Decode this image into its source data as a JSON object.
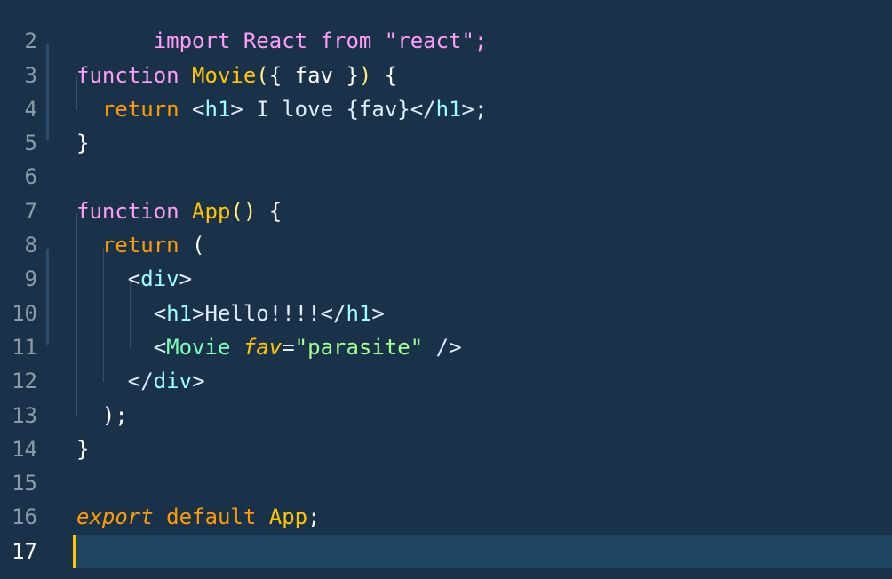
{
  "editor": {
    "line_numbers": [
      "2",
      "3",
      "4",
      "5",
      "6",
      "7",
      "8",
      "9",
      "10",
      "11",
      "12",
      "13",
      "14",
      "15",
      "16",
      "17"
    ],
    "active_line": "17",
    "lines": [
      {
        "top_partial": "import React from \"react\";"
      },
      {
        "t1": "function",
        "t2": " ",
        "t3": "Movie",
        "t4": "(",
        "t5": "{ fav }",
        "t6": ")",
        "t7": " {"
      },
      {
        "t1": "  ",
        "t2": "return",
        "t3": " <",
        "t4": "h1",
        "t5": "> I love {fav}</",
        "t6": "h1",
        "t7": ">;"
      },
      {
        "t1": "}"
      },
      {
        "t1": ""
      },
      {
        "t1": "function",
        "t2": " ",
        "t3": "App",
        "t4": "()",
        "t5": " {"
      },
      {
        "t1": "  ",
        "t2": "return",
        "t3": " ("
      },
      {
        "t1": "    <",
        "t2": "div",
        "t3": ">"
      },
      {
        "t1": "      <",
        "t2": "h1",
        "t3": ">Hello!!!!</",
        "t4": "h1",
        "t5": ">"
      },
      {
        "t1": "      <",
        "t2": "Movie",
        "t3": " ",
        "t4": "fav",
        "t5": "=",
        "t6": "\"parasite\"",
        "t7": " />"
      },
      {
        "t1": "    </",
        "t2": "div",
        "t3": ">"
      },
      {
        "t1": "  );"
      },
      {
        "t1": "}"
      },
      {
        "t1": ""
      },
      {
        "t1": "export",
        "t2": " ",
        "t3": "default",
        "t4": " ",
        "t5": "App",
        "t6": ";"
      },
      {
        "t1": ""
      }
    ]
  },
  "colors": {
    "background": "#19324a",
    "current_line": "#1f4462",
    "cursor": "#ffc600",
    "keyword_function": "#ff9df7",
    "keyword": "#ff9d00",
    "function_name": "#ffc600",
    "tag": "#9effff",
    "component_tag": "#80ffbb",
    "string": "#a5ff90"
  }
}
